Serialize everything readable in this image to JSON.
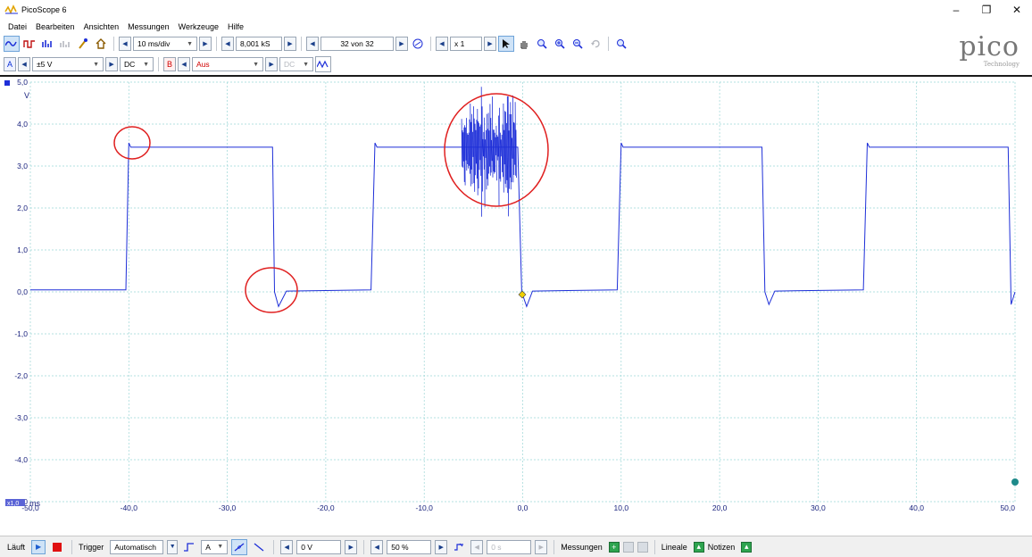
{
  "window": {
    "title": "PicoScope 6",
    "controls": [
      "–",
      "❐",
      "✕"
    ]
  },
  "menu": [
    "Datei",
    "Bearbeiten",
    "Ansichten",
    "Messungen",
    "Werkzeuge",
    "Hilfe"
  ],
  "toolbar": {
    "timebase": "10 ms/div",
    "samples": "8,001 kS",
    "buffer": "32 von 32",
    "zoom": "x 1"
  },
  "channels": {
    "a": {
      "label": "A",
      "range": "±5 V",
      "coupling": "DC"
    },
    "b": {
      "label": "B",
      "range": "Aus",
      "coupling": "DC"
    }
  },
  "logo": {
    "main": "pico",
    "sub": "Technology"
  },
  "axis": {
    "y_unit": "V",
    "x_unit": "ms",
    "x_badge": "x1,0",
    "y_ticks": [
      "5,0",
      "4,0",
      "3,0",
      "2,0",
      "1,0",
      "0,0",
      "-1,0",
      "-2,0",
      "-3,0",
      "-4,0",
      "-5,0"
    ],
    "x_ticks": [
      "-50,0",
      "-40,0",
      "-30,0",
      "-20,0",
      "-10,0",
      "0,0",
      "10,0",
      "20,0",
      "30,0",
      "40,0",
      "50,0"
    ]
  },
  "colors": {
    "trace": "#1e2fd8",
    "annotation": "#e02020",
    "grid": "#9ad6d6",
    "trigger": "#f0d000",
    "ruler_marker": "#1e8a8a"
  },
  "chart_data": {
    "type": "line",
    "xlim": [
      -50,
      50
    ],
    "ylim": [
      -5,
      5
    ],
    "grid": true,
    "series": [
      {
        "x": [
          -50,
          -40.3,
          -40,
          -39.8,
          -38.6,
          -25.4,
          -25.2,
          -24.8,
          -24,
          -15.4,
          -15,
          -14.8,
          -13.5,
          -0.5,
          -0.1,
          0.4,
          1,
          9.6,
          10,
          10.2,
          11,
          24.3,
          24.6,
          25,
          25.6,
          34.6,
          35,
          35.2,
          36,
          49.3,
          49.6,
          50
        ],
        "y": [
          0.05,
          0.05,
          3.55,
          3.45,
          3.45,
          3.45,
          0.0,
          -0.35,
          0.02,
          0.05,
          3.55,
          3.45,
          3.45,
          3.45,
          0.0,
          -0.35,
          0.02,
          0.05,
          3.55,
          3.45,
          3.45,
          3.45,
          0.0,
          -0.3,
          0.02,
          0.05,
          3.55,
          3.45,
          3.45,
          3.45,
          -0.3,
          0.0
        ]
      }
    ]
  },
  "status": {
    "running": "Läuft",
    "trigger_label": "Trigger",
    "trigger_mode": "Automatisch",
    "trigger_channel": "A",
    "threshold": "0 V",
    "pretrigger": "50 %",
    "delay": "0 s",
    "measurements": "Messungen",
    "rulers": "Lineale",
    "notes": "Notizen"
  }
}
